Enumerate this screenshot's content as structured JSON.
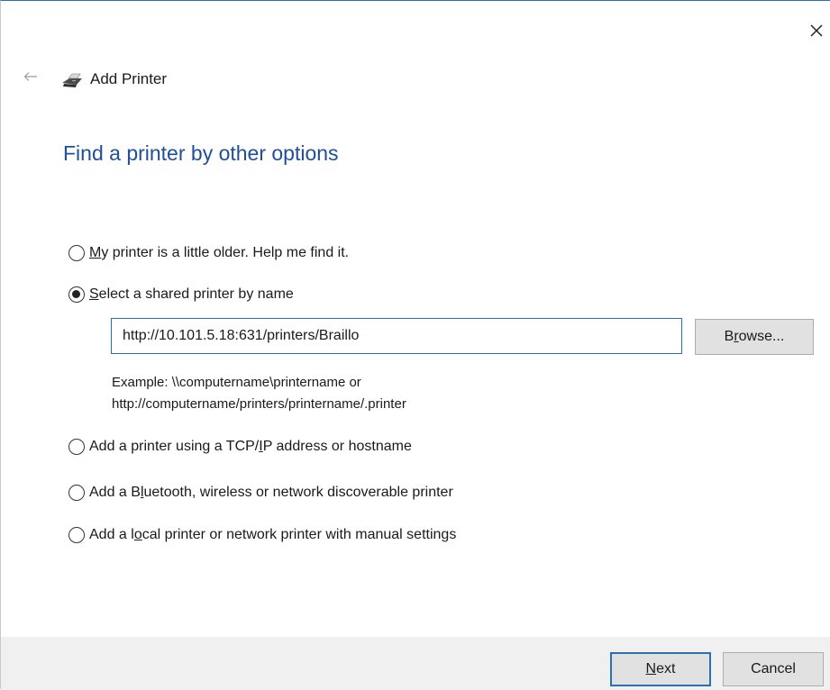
{
  "window": {
    "close_glyph": "✕",
    "back_glyph": "←"
  },
  "header": {
    "icon": "printer-icon",
    "title": "Add Printer"
  },
  "page_title": "Find a printer by other options",
  "options": [
    {
      "pre": "",
      "key": "M",
      "post": "y printer is a little older. Help me find it.",
      "checked": false
    },
    {
      "pre": "",
      "key": "S",
      "post": "elect a shared printer by name",
      "checked": true
    },
    {
      "pre": "Add a printer using a TCP/",
      "key": "I",
      "post": "P address or hostname",
      "checked": false
    },
    {
      "pre": "Add a B",
      "key": "l",
      "post": "uetooth, wireless or network discoverable printer",
      "checked": false
    },
    {
      "pre": "Add a l",
      "key": "o",
      "post": "cal printer or network printer with manual settings",
      "checked": false
    }
  ],
  "shared_printer": {
    "value": "http://10.101.5.18:631/printers/Braillo",
    "browse_pre": "B",
    "browse_key": "r",
    "browse_post": "owse...",
    "example_line1": "Example: \\\\computername\\printername or",
    "example_line2": "http://computername/printers/printername/.printer"
  },
  "footer": {
    "next_key": "N",
    "next_post": "ext",
    "cancel": "Cancel"
  },
  "colors": {
    "accent": "#2b6fb7",
    "title": "#1f4e9c",
    "footer_bg": "#f0f0f0"
  }
}
